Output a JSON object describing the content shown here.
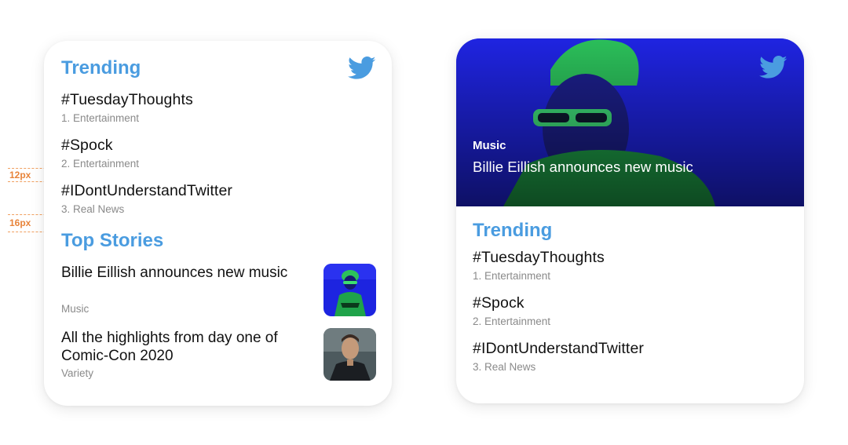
{
  "annotations": {
    "gap1": "12px",
    "gap2": "16px"
  },
  "colors": {
    "accent": "#4a9ce0",
    "hero_bg": "#1a1fd8",
    "hero_highlight": "#2bbf5a"
  },
  "left_card": {
    "trending_title": "Trending",
    "trends": [
      {
        "tag": "#TuesdayThoughts",
        "sub": "1. Entertainment"
      },
      {
        "tag": "#Spock",
        "sub": "2. Entertainment"
      },
      {
        "tag": "#IDontUnderstandTwitter",
        "sub": "3. Real News"
      }
    ],
    "top_stories_title": "Top Stories",
    "stories": [
      {
        "title": "Billie Eillish announces new music",
        "sub": "Music",
        "thumb_icon": "music-photo"
      },
      {
        "title": "All the highlights from day one of Comic-Con 2020",
        "sub": "Variety",
        "thumb_icon": "portrait-photo"
      }
    ],
    "logo_icon": "twitter-bird-icon"
  },
  "right_card": {
    "hero": {
      "category": "Music",
      "title": "Billie Eillish announces new music"
    },
    "trending_title": "Trending",
    "trends": [
      {
        "tag": "#TuesdayThoughts",
        "sub": "1. Entertainment"
      },
      {
        "tag": "#Spock",
        "sub": "2. Entertainment"
      },
      {
        "tag": "#IDontUnderstandTwitter",
        "sub": "3. Real News"
      }
    ],
    "logo_icon": "twitter-bird-icon"
  }
}
